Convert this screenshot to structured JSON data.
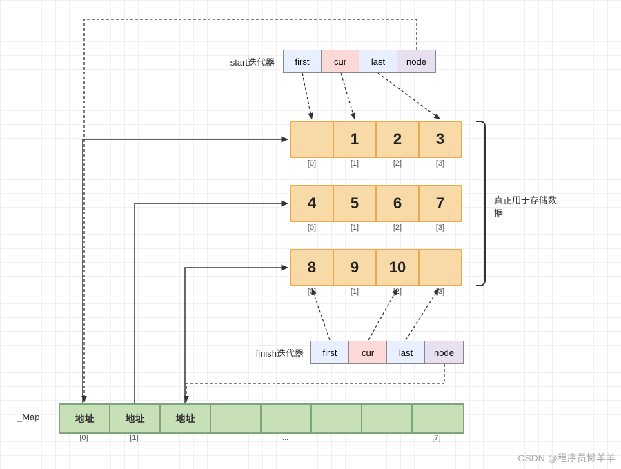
{
  "start_iterator": {
    "label": "start迭代器",
    "cells": [
      "first",
      "cur",
      "last",
      "node"
    ]
  },
  "finish_iterator": {
    "label": "finish迭代器",
    "cells": [
      "first",
      "cur",
      "last",
      "node"
    ]
  },
  "buffers": [
    {
      "values": [
        "",
        "1",
        "2",
        "3"
      ],
      "indices": [
        "[0]",
        "[1]",
        "[2]",
        "[3]"
      ]
    },
    {
      "values": [
        "4",
        "5",
        "6",
        "7"
      ],
      "indices": [
        "[0]",
        "[1]",
        "[2]",
        "[3]"
      ]
    },
    {
      "values": [
        "8",
        "9",
        "10",
        ""
      ],
      "indices": [
        "[0]",
        "[1]",
        "[2]",
        "[3]"
      ]
    }
  ],
  "annotation": "真正用于存储数据",
  "map": {
    "label": "_Map",
    "cells": [
      "地址",
      "地址",
      "地址",
      "",
      "",
      "",
      "",
      ""
    ],
    "indices": [
      "[0]",
      "[1]",
      "",
      "",
      "...",
      "",
      "",
      "[7]"
    ]
  },
  "watermark": "CSDN @程序员懒羊羊"
}
